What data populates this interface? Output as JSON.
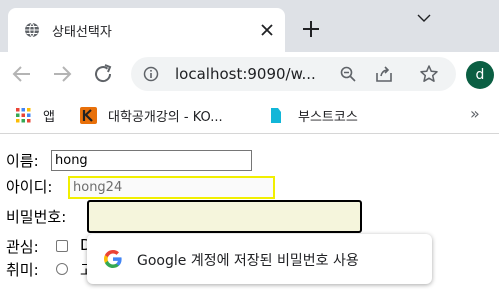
{
  "tab": {
    "title": "상태선택자"
  },
  "toolbar": {
    "url": "localhost:9090/w...",
    "profile_initial": "d"
  },
  "bookmarks": {
    "items": [
      {
        "label": "앱"
      },
      {
        "label": "대학공개강의 - KO..."
      },
      {
        "label": "부스트코스"
      }
    ],
    "more": "»"
  },
  "form": {
    "name_label": "이름:",
    "name_value": "hong",
    "id_label": "아이디:",
    "id_value": "hong24",
    "password_label": "비밀번호:",
    "password_value": "",
    "interest_label": "관심:",
    "interest_option_first": "D",
    "hobby_label": "취미:",
    "hobby_option_first": "고"
  },
  "autofill_popup": {
    "text": "Google 계정에 저장된 비밀번호 사용"
  },
  "colors": {
    "tabstrip": "#dee1e6",
    "omnibox": "#f1f3f4",
    "avatar": "#0b5f43",
    "readonly_border": "#f1ef00",
    "focus_bg": "#f5f5dc"
  }
}
